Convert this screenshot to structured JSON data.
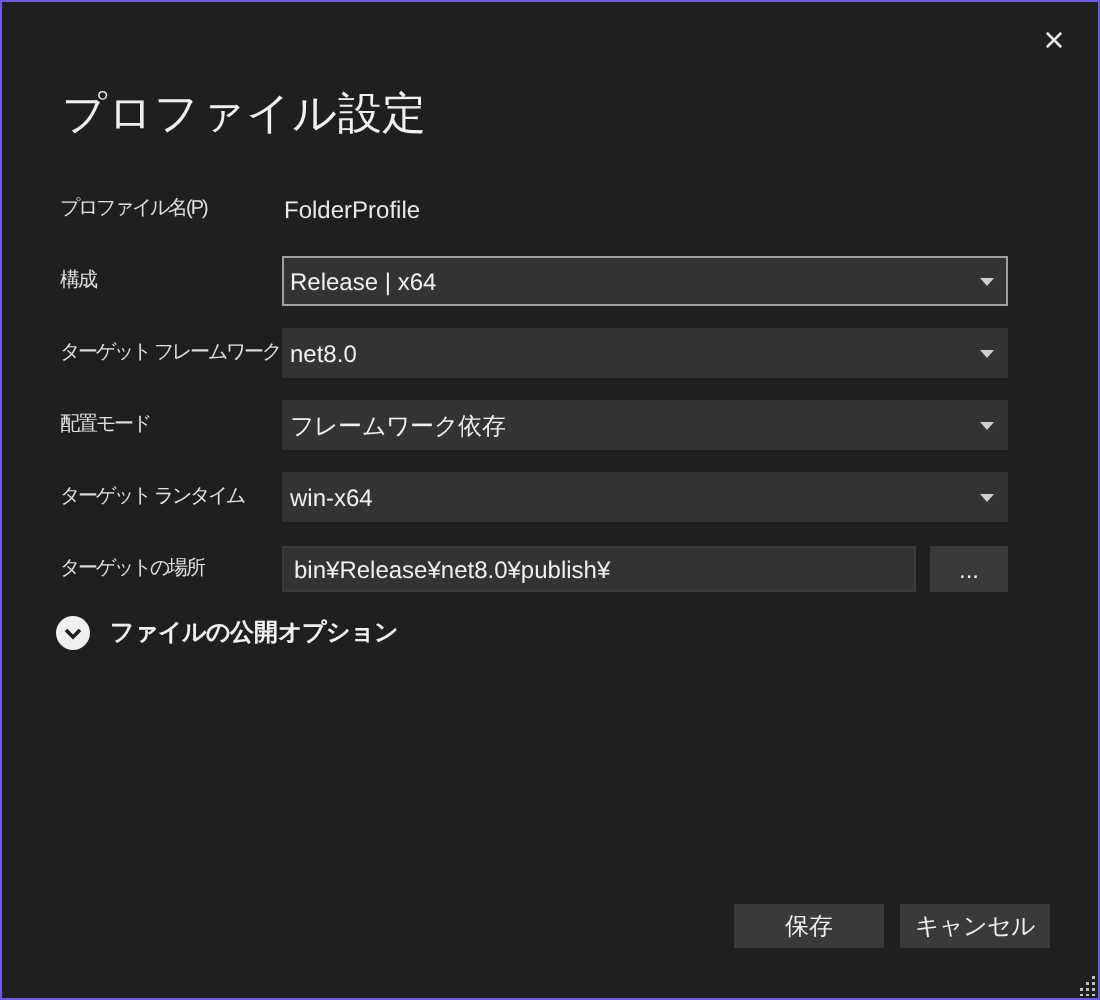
{
  "window": {
    "title": "プロファイル設定",
    "close": "×"
  },
  "fields": [
    {
      "label": "プロファイル名(P)",
      "kind": "static",
      "value": "FolderProfile"
    },
    {
      "label": "構成",
      "kind": "dropdown",
      "value": "Release | x64",
      "focused": true
    },
    {
      "label": "ターゲット フレームワーク",
      "kind": "dropdown",
      "value": "net8.0",
      "focused": false
    },
    {
      "label": "配置モード",
      "kind": "dropdown",
      "value": "フレームワーク依存",
      "focused": false
    },
    {
      "label": "ターゲット ランタイム",
      "kind": "dropdown",
      "value": "win-x64",
      "focused": false
    },
    {
      "label": "ターゲットの場所",
      "kind": "path",
      "value": "bin¥Release¥net8.0¥publish¥",
      "browse": "..."
    }
  ],
  "expander": {
    "label": "ファイルの公開オプション",
    "expanded": false
  },
  "buttons": [
    "保存",
    "キャンセル"
  ]
}
